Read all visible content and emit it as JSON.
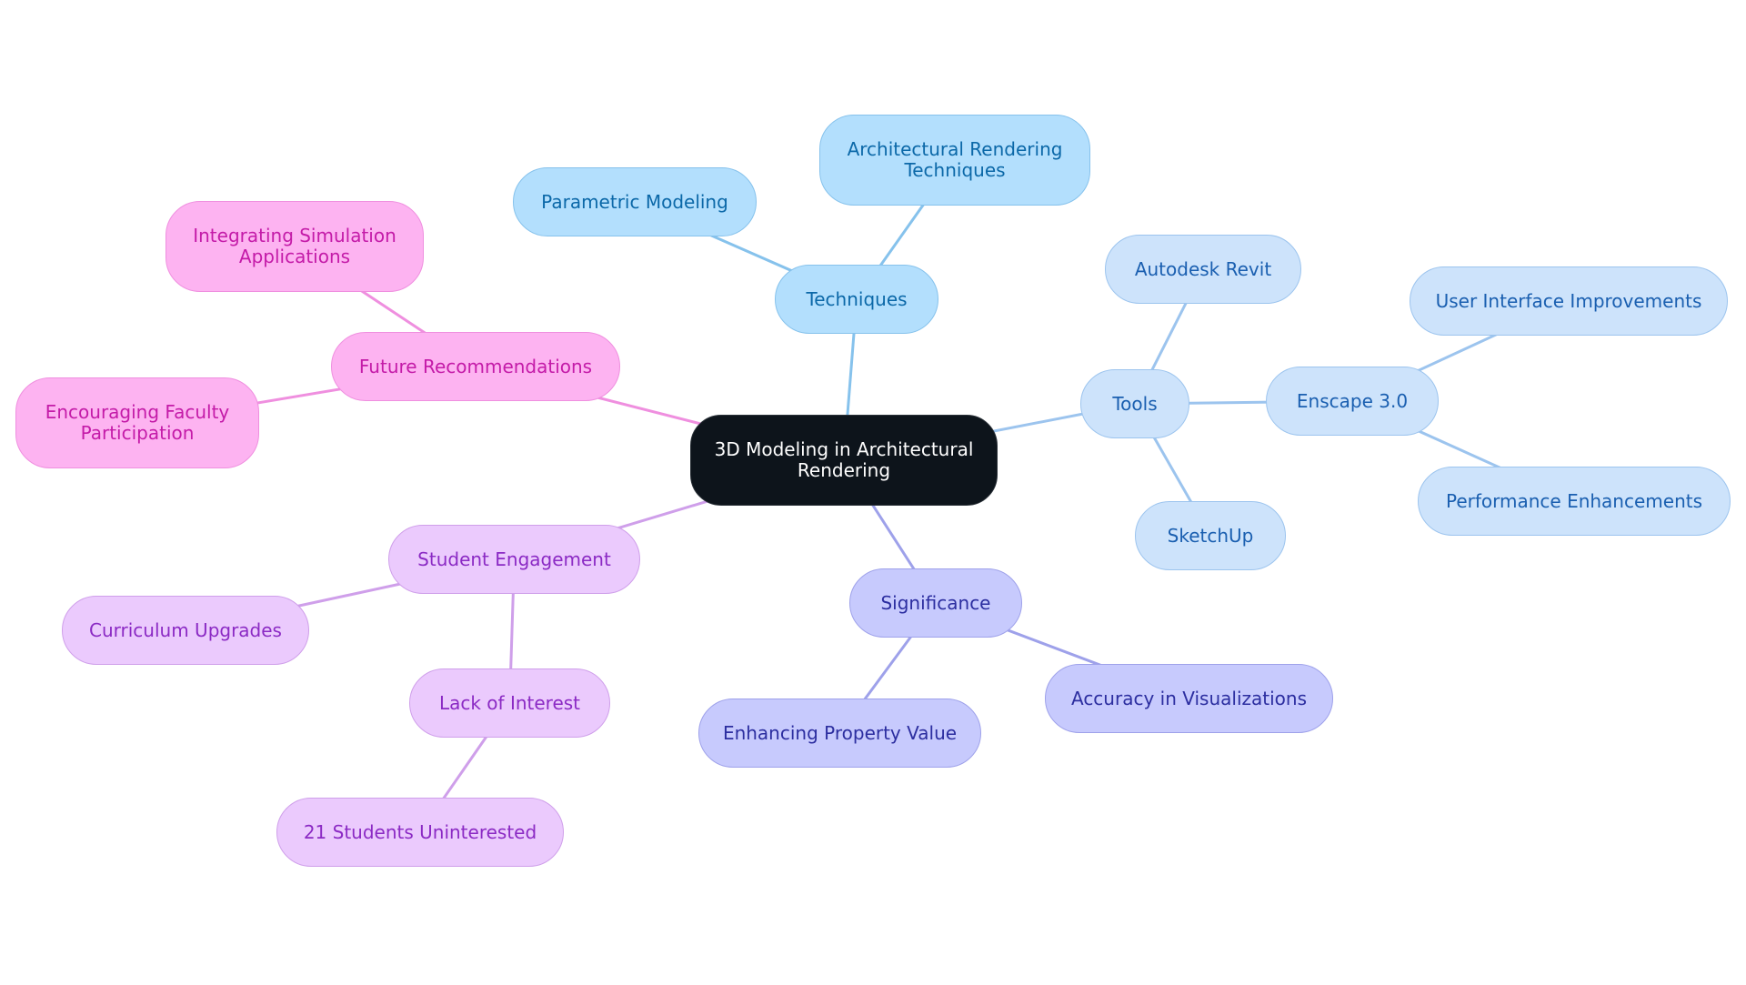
{
  "diagram": {
    "type": "mindmap",
    "root": {
      "id": "root",
      "label": "3D Modeling in Architectural\nRendering"
    },
    "colors": {
      "root": "#0d141b",
      "techniques": "#b3dffd",
      "tools": "#cde3fb",
      "significance": "#c7cafd",
      "student_engagement": "#ebcafd",
      "future_recommendations": "#fdb3f1"
    },
    "nodes": [
      {
        "id": "techniques",
        "label": "Techniques",
        "parent": "root",
        "group": "tech"
      },
      {
        "id": "parametric",
        "label": "Parametric Modeling",
        "parent": "techniques",
        "group": "tech"
      },
      {
        "id": "arch-render",
        "label": "Architectural Rendering\nTechniques",
        "parent": "techniques",
        "group": "tech"
      },
      {
        "id": "tools",
        "label": "Tools",
        "parent": "root",
        "group": "tool"
      },
      {
        "id": "revit",
        "label": "Autodesk Revit",
        "parent": "tools",
        "group": "tool"
      },
      {
        "id": "enscape",
        "label": "Enscape 3.0",
        "parent": "tools",
        "group": "tool"
      },
      {
        "id": "ui-improve",
        "label": "User Interface Improvements",
        "parent": "enscape",
        "group": "tool"
      },
      {
        "id": "perf",
        "label": "Performance Enhancements",
        "parent": "enscape",
        "group": "tool"
      },
      {
        "id": "sketchup",
        "label": "SketchUp",
        "parent": "tools",
        "group": "tool"
      },
      {
        "id": "significance",
        "label": "Significance",
        "parent": "root",
        "group": "sig"
      },
      {
        "id": "accuracy",
        "label": "Accuracy in Visualizations",
        "parent": "significance",
        "group": "sig"
      },
      {
        "id": "property",
        "label": "Enhancing Property Value",
        "parent": "significance",
        "group": "sig"
      },
      {
        "id": "student",
        "label": "Student Engagement",
        "parent": "root",
        "group": "stud"
      },
      {
        "id": "curriculum",
        "label": "Curriculum Upgrades",
        "parent": "student",
        "group": "stud"
      },
      {
        "id": "lack",
        "label": "Lack of Interest",
        "parent": "student",
        "group": "stud"
      },
      {
        "id": "21students",
        "label": "21 Students Uninterested",
        "parent": "lack",
        "group": "stud"
      },
      {
        "id": "future",
        "label": "Future Recommendations",
        "parent": "root",
        "group": "fut"
      },
      {
        "id": "simulation",
        "label": "Integrating Simulation\nApplications",
        "parent": "future",
        "group": "fut"
      },
      {
        "id": "faculty",
        "label": "Encouraging Faculty\nParticipation",
        "parent": "future",
        "group": "fut"
      }
    ]
  }
}
